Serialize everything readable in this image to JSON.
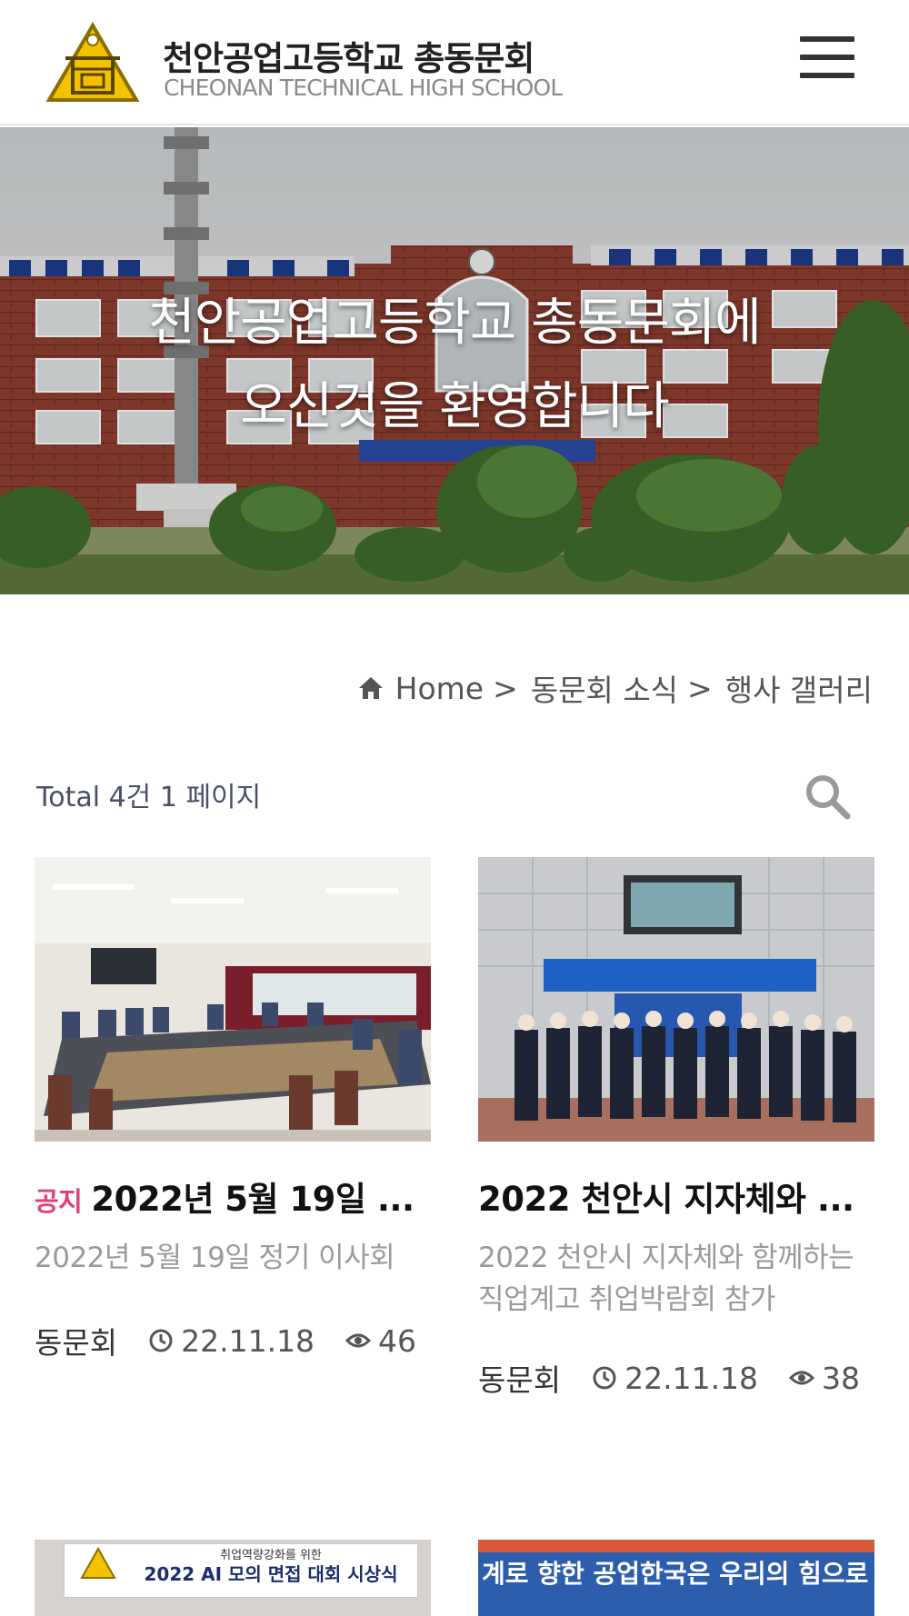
{
  "header": {
    "title_ko": "천안공업고등학교 총동문회",
    "title_en": "CHEONAN TECHNICAL HIGH SCHOOL",
    "logo_icon": "school-emblem-icon",
    "menu_icon": "hamburger-menu-icon"
  },
  "hero": {
    "line1": "천안공업고등학교 총동문회에",
    "line2": "오신것을 환영합니다"
  },
  "breadcrumb": {
    "home_icon": "home-icon",
    "home": "Home",
    "sep1": ">",
    "section": "동문회 소식",
    "sep2": ">",
    "page": "행사 갤러리"
  },
  "list": {
    "total_text": "Total 4건 1 페이지",
    "search_icon": "search-icon"
  },
  "posts": [
    {
      "badge": "공지",
      "title": "2022년 5월 19일 ...",
      "excerpt": "2022년 5월 19일 정기 이사회",
      "author": "동문회",
      "date": "22.11.18",
      "views": "46"
    },
    {
      "badge": "",
      "title": "2022 천안시 지자체와 ...",
      "excerpt": "2022 천안시 지자체와 함께하는 직업계고 취업박람회 참가",
      "author": "동문회",
      "date": "22.11.18",
      "views": "38"
    },
    {
      "banner_small": "취업역량강화를 위한",
      "banner_main": "2022 AI 모의 면접 대회 시상식"
    },
    {
      "banner_main": "계로 향한 공업한국은 우리의 힘으로"
    }
  ],
  "colors": {
    "accent_notice": "#e0407b",
    "logo_yellow": "#f2c200",
    "text_dark": "#222222",
    "text_muted": "#9a9a9a"
  }
}
